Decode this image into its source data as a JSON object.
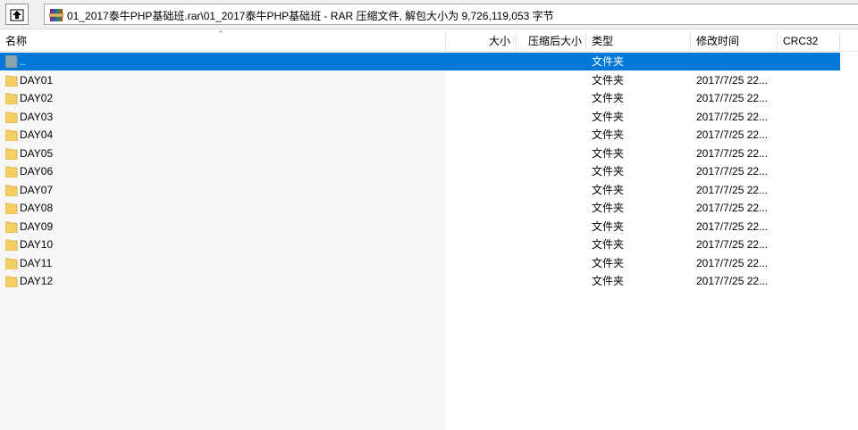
{
  "toolbar": {
    "path": "01_2017泰牛PHP基础班.rar\\01_2017泰牛PHP基础班 - RAR 压缩文件, 解包大小为 9,726,119,053 字节"
  },
  "icons": {
    "up": "up-folder-icon",
    "archive": "rar-archive-icon",
    "folder": "folder-icon"
  },
  "columns": {
    "name": "名称",
    "size": "大小",
    "packed": "压缩后大小",
    "type": "类型",
    "modified": "修改时间",
    "crc": "CRC32"
  },
  "colors": {
    "selection": "#0078d7",
    "folder": "#f4cf66"
  },
  "rows": [
    {
      "name": "..",
      "type": "文件夹",
      "modified": ""
    },
    {
      "name": "DAY01",
      "type": "文件夹",
      "modified": "2017/7/25 22..."
    },
    {
      "name": "DAY02",
      "type": "文件夹",
      "modified": "2017/7/25 22..."
    },
    {
      "name": "DAY03",
      "type": "文件夹",
      "modified": "2017/7/25 22..."
    },
    {
      "name": "DAY04",
      "type": "文件夹",
      "modified": "2017/7/25 22..."
    },
    {
      "name": "DAY05",
      "type": "文件夹",
      "modified": "2017/7/25 22..."
    },
    {
      "name": "DAY06",
      "type": "文件夹",
      "modified": "2017/7/25 22..."
    },
    {
      "name": "DAY07",
      "type": "文件夹",
      "modified": "2017/7/25 22..."
    },
    {
      "name": "DAY08",
      "type": "文件夹",
      "modified": "2017/7/25 22..."
    },
    {
      "name": "DAY09",
      "type": "文件夹",
      "modified": "2017/7/25 22..."
    },
    {
      "name": "DAY10",
      "type": "文件夹",
      "modified": "2017/7/25 22..."
    },
    {
      "name": "DAY11",
      "type": "文件夹",
      "modified": "2017/7/25 22..."
    },
    {
      "name": "DAY12",
      "type": "文件夹",
      "modified": "2017/7/25 22..."
    }
  ]
}
